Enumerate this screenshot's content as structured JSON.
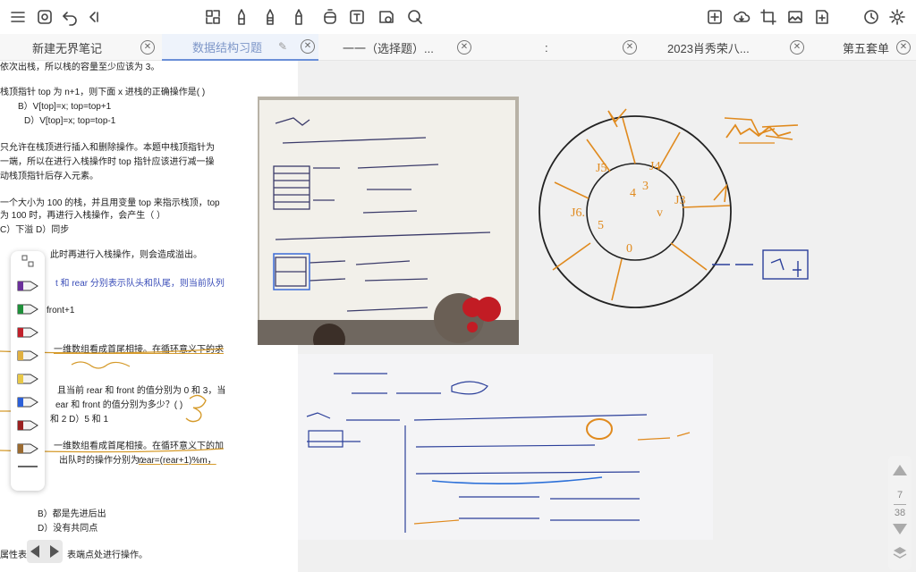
{
  "tabs": [
    {
      "label": "新建无界笔记",
      "active": false
    },
    {
      "label": "数据结构习题",
      "active": true
    },
    {
      "label": "一一（选择题）...",
      "active": false
    },
    {
      "label": ":",
      "active": false
    },
    {
      "label": "2023肖秀荣八...",
      "active": false
    },
    {
      "label": "第五套单",
      "active": false
    }
  ],
  "left_text": {
    "l01": "依次出栈，所以栈的容量至少应该为 3。",
    "l02": "栈顶指针 top 为 n+1，则下面 x 进栈的正确操作是(      )",
    "l03": "B）V[top]=x; top=top+1",
    "l04": "D）V[top]=x; top=top-1",
    "l05": "只允许在栈顶进行插入和删除操作。本题中栈顶指针为",
    "l06": "一端，所以在进行入栈操作时 top 指针应该进行减一操",
    "l07": "动栈顶指针后存入元素。",
    "l08": "一个大小为 100 的栈，并且用变量 top 来指示栈顶，top",
    "l09": "为 100 时，再进行入栈操作，会产生（    ）",
    "l10": "C）下溢        D）同步",
    "l11": "此时再进行入栈操作，则会造成溢出。",
    "l12": "t 和 rear 分别表示队头和队尾，则当前队列",
    "l13": "front+1",
    "l14": "一维数组看成首尾相接。在循环意义下的求",
    "l15": "且当前 rear 和 front 的值分别为 0 和 3，当",
    "l16": "ear 和 front 的值分别为多少？(   )",
    "l17": "和 2            D）5 和 1",
    "l18": "一维数组看成首尾相接。在循环意义下的加",
    "l19": "出队时的操作分别为：",
    "l19b": "rear=(rear+1)%m，",
    "l20": "B）都是先进后出",
    "l21": "D）没有共同点",
    "l22": "属性表。",
    "l23": "表端点处进行操作。"
  },
  "page_nav": {
    "current": "7",
    "total": "38"
  },
  "colors": {
    "accent": "#6a8fd8",
    "tab_active_text": "#7d96c8",
    "highlight": "#d59a2a",
    "blue_text": "#3a4db8"
  }
}
